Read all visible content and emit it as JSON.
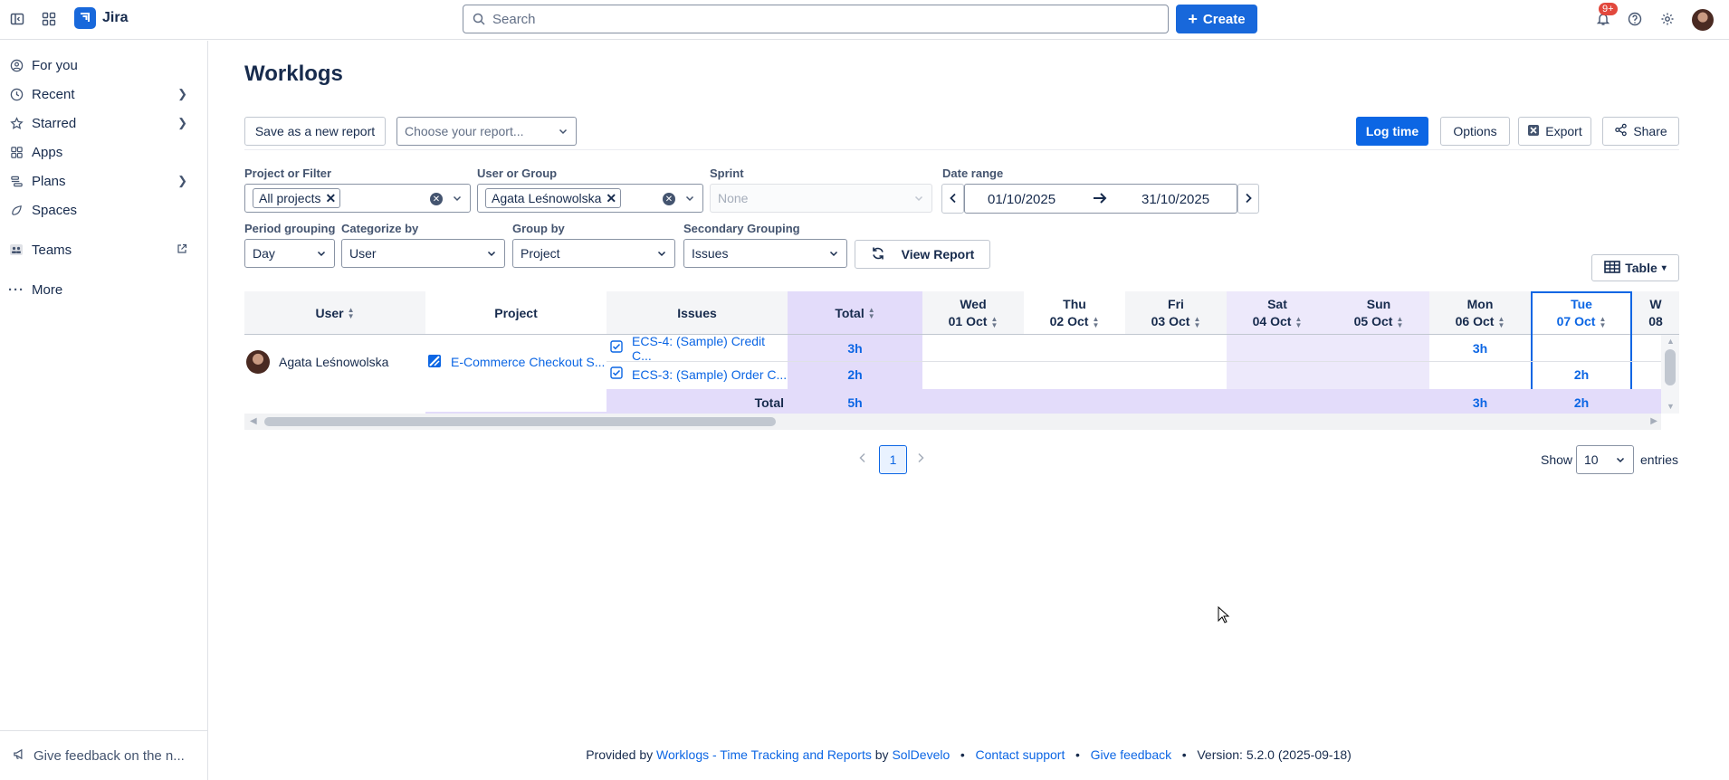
{
  "topbar": {
    "app_name": "Jira",
    "search_placeholder": "Search",
    "create_label": "Create",
    "notification_badge": "9+"
  },
  "sidebar": {
    "items": [
      {
        "label": "For you",
        "icon": "user-circle-icon"
      },
      {
        "label": "Recent",
        "icon": "clock-icon"
      },
      {
        "label": "Starred",
        "icon": "star-icon"
      },
      {
        "label": "Apps",
        "icon": "apps-icon"
      },
      {
        "label": "Plans",
        "icon": "plans-icon"
      },
      {
        "label": "Spaces",
        "icon": "spaces-icon"
      },
      {
        "label": "Teams",
        "icon": "teams-icon"
      },
      {
        "label": "More",
        "icon": "more-icon"
      }
    ],
    "feedback_label": "Give feedback on the n..."
  },
  "page": {
    "title": "Worklogs",
    "save_report_label": "Save as a new report",
    "choose_report_placeholder": "Choose your report...",
    "log_time_label": "Log time",
    "options_label": "Options",
    "export_label": "Export",
    "share_label": "Share"
  },
  "filters": {
    "project_label": "Project or Filter",
    "project_tag": "All projects",
    "user_label": "User or Group",
    "user_tag": "Agata Leśnowolska",
    "sprint_label": "Sprint",
    "sprint_value": "None",
    "date_range_label": "Date range",
    "date_from": "01/10/2025",
    "date_to": "31/10/2025",
    "period_label": "Period grouping",
    "period_value": "Day",
    "categorize_label": "Categorize by",
    "categorize_value": "User",
    "group_label": "Group by",
    "group_value": "Project",
    "secondary_label": "Secondary Grouping",
    "secondary_value": "Issues",
    "view_report_label": "View Report",
    "view_mode": "Table"
  },
  "table": {
    "headers": {
      "user": "User",
      "project": "Project",
      "issues": "Issues",
      "total": "Total"
    },
    "days": [
      {
        "dow": "Wed",
        "date": "01 Oct"
      },
      {
        "dow": "Thu",
        "date": "02 Oct"
      },
      {
        "dow": "Fri",
        "date": "03 Oct"
      },
      {
        "dow": "Sat",
        "date": "04 Oct"
      },
      {
        "dow": "Sun",
        "date": "05 Oct"
      },
      {
        "dow": "Mon",
        "date": "06 Oct"
      },
      {
        "dow": "Tue",
        "date": "07 Oct"
      },
      {
        "dow": "W",
        "date": "08"
      }
    ],
    "user_name": "Agata Leśnowolska",
    "project_name": "E-Commerce Checkout S...",
    "rows": [
      {
        "issue": "ECS-4: (Sample) Credit C...",
        "total": "3h",
        "mon": "3h",
        "tue": ""
      },
      {
        "issue": "ECS-3: (Sample) Order C...",
        "total": "2h",
        "mon": "",
        "tue": "2h"
      }
    ],
    "total_row": {
      "label": "Total",
      "total": "5h",
      "mon": "3h",
      "tue": "2h"
    }
  },
  "pagination": {
    "current_page": "1",
    "show_label": "Show",
    "entries_value": "10",
    "entries_label": "entries"
  },
  "footer": {
    "provided_by": "Provided by",
    "app_link": "Worklogs - Time Tracking and Reports",
    "by": "by",
    "vendor_link": "SolDevelo",
    "contact_link": "Contact support",
    "feedback_link": "Give feedback",
    "version": "Version: 5.2.0 (2025-09-18)"
  },
  "colors": {
    "accent": "#0c66e4",
    "total_column_bg": "#e3dcfa",
    "highlight_border": "#0c66e4"
  }
}
